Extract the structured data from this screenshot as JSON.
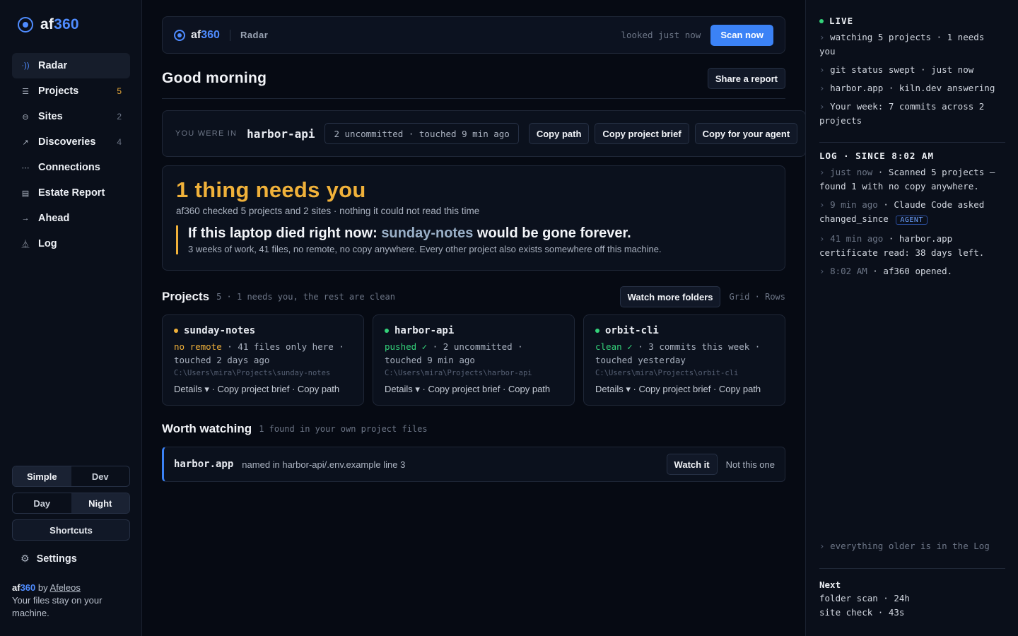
{
  "brand": {
    "name_a": "af",
    "name_b": "360"
  },
  "sidebar": {
    "items": [
      {
        "icon": "radar-icon",
        "glyph": "·))",
        "label": "Radar",
        "count": "",
        "active": true
      },
      {
        "icon": "list-icon",
        "glyph": "☰",
        "label": "Projects",
        "count": "5",
        "warn": true
      },
      {
        "icon": "globe-icon",
        "glyph": "⊖",
        "label": "Sites",
        "count": "2"
      },
      {
        "icon": "trend-icon",
        "glyph": "↗",
        "label": "Discoveries",
        "count": "4"
      },
      {
        "icon": "connections-icon",
        "glyph": "⋯",
        "label": "Connections",
        "count": ""
      },
      {
        "icon": "report-icon",
        "glyph": "▤",
        "label": "Estate Report",
        "count": ""
      },
      {
        "icon": "ahead-icon",
        "glyph": "→",
        "label": "Ahead",
        "count": ""
      },
      {
        "icon": "log-icon",
        "glyph": "⏅",
        "label": "Log",
        "count": ""
      }
    ],
    "mode": {
      "simple": "Simple",
      "dev": "Dev"
    },
    "theme": {
      "day": "Day",
      "night": "Night"
    },
    "shortcuts": "Shortcuts",
    "settings": "Settings",
    "footer": {
      "brand_a": "af",
      "brand_b": "360",
      "by": "by",
      "author": "Afeleos",
      "note": "Your files stay on your machine."
    }
  },
  "topbar": {
    "brand_a": "af",
    "brand_b": "360",
    "crumb": "Radar",
    "looked": "looked just now",
    "scan": "Scan now"
  },
  "greeting": {
    "text": "Good morning",
    "share": "Share a report"
  },
  "you_were": {
    "label": "YOU WERE IN",
    "project": "harbor-api",
    "status": "2 uncommitted · touched 9 min ago",
    "copy_path": "Copy path",
    "copy_brief": "Copy project brief",
    "copy_agent": "Copy for your agent"
  },
  "alert": {
    "title": "1 thing needs you",
    "subtitle": "af360 checked 5 projects and 2 sites · nothing it could not read this time",
    "head_a": "If this laptop died right now:",
    "head_hl": "sunday-notes",
    "head_b": "would be gone forever.",
    "detail": "3 weeks of work, 41 files, no remote, no copy anywhere. Every other project also exists somewhere off this machine."
  },
  "projects": {
    "title": "Projects",
    "meta": "5 · 1 needs you, the rest are clean",
    "watch_more": "Watch more folders",
    "grid": "Grid",
    "sep": "·",
    "rows": "Rows",
    "cards": [
      {
        "name": "sunday-notes",
        "dot": "#f0b13a",
        "status": "no remote",
        "status_class": "st-warn",
        "line_a": " · 41 files only here ·",
        "line_b": "touched 2 days ago",
        "path": "C:\\Users\\mira\\Projects\\sunday-notes",
        "details": "Details ▾",
        "brief": "Copy project brief",
        "copy": "Copy path"
      },
      {
        "name": "harbor-api",
        "dot": "#34d27a",
        "status": "pushed ✓",
        "status_class": "st-ok",
        "line_a": " · 2 uncommitted ·",
        "line_b": "touched 9 min ago",
        "path": "C:\\Users\\mira\\Projects\\harbor-api",
        "details": "Details ▾",
        "brief": "Copy project brief",
        "copy": "Copy path"
      },
      {
        "name": "orbit-cli",
        "dot": "#34d27a",
        "status": "clean ✓",
        "status_class": "st-ok",
        "line_a": " · 3 commits this week ·",
        "line_b": "touched yesterday",
        "path": "C:\\Users\\mira\\Projects\\orbit-cli",
        "details": "Details ▾",
        "brief": "Copy project brief",
        "copy": "Copy path"
      }
    ]
  },
  "worth": {
    "title": "Worth watching",
    "meta": "1 found in your own project files",
    "name": "harbor.app",
    "desc": "named in harbor-api/.env.example line 3",
    "watch": "Watch it",
    "no": "Not this one"
  },
  "panel": {
    "live": "LIVE",
    "live_lines": [
      "watching 5 projects · 1 needs you",
      "git status swept · just now",
      "harbor.app · kiln.dev answering",
      "Your week: 7 commits across 2 projects"
    ],
    "log_title": "LOG · SINCE 8:02 AM",
    "log": [
      {
        "time": "just now",
        "text": " · Scanned 5 projects — found 1 with no copy anywhere."
      },
      {
        "time": "9 min ago",
        "text": " · Claude Code asked changed_since",
        "tag": "AGENT"
      },
      {
        "time": "41 min ago",
        "text": " · harbor.app certificate read: 38 days left."
      },
      {
        "time": "8:02 AM",
        "text": " · af360 opened."
      }
    ],
    "older": "everything older is in the Log",
    "next_title": "Next",
    "next": [
      "folder scan · 24h",
      "site check · 43s"
    ]
  },
  "colors": {
    "accent": "#4f8cff",
    "warn": "#f0b13a",
    "ok": "#34d27a",
    "bg": "#060a13"
  }
}
